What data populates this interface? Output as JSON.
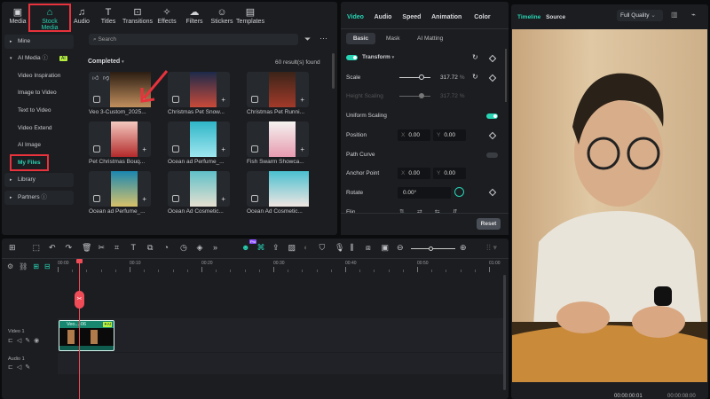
{
  "toolbar": {
    "tabs": [
      {
        "label": "Media",
        "icon": "media-icon"
      },
      {
        "label": "Stock Media",
        "icon": "stock-media-icon",
        "selected": true
      },
      {
        "label": "Audio",
        "icon": "audio-icon"
      },
      {
        "label": "Titles",
        "icon": "titles-icon"
      },
      {
        "label": "Transitions",
        "icon": "transitions-icon"
      },
      {
        "label": "Effects",
        "icon": "effects-icon"
      },
      {
        "label": "Filters",
        "icon": "filters-icon"
      },
      {
        "label": "Stickers",
        "icon": "stickers-icon"
      },
      {
        "label": "Templates",
        "icon": "templates-icon"
      }
    ]
  },
  "sidebar": {
    "mine": "Mine",
    "ai_media": "AI Media",
    "ai_badge": "AI",
    "items": [
      "Video Inspiration",
      "Image to Video",
      "Text to Video",
      "Video Extend",
      "AI Image",
      "My Files"
    ],
    "library": "Library",
    "partners": "Partners"
  },
  "library": {
    "search_placeholder": "Search",
    "section": "Completed",
    "results": "60 result(s) found",
    "cards": [
      "Veo 3-Custom_2025...",
      "Christmas Pet Snow...",
      "Christmas Pet Runni...",
      "Pet Christmas Bouq...",
      "Ocean ad Perfume_...",
      "Fish Swarm Showca...",
      "Ocean ad Perfume_...",
      "Ocean Ad Cosmetic...",
      "Ocean Ad Cosmetic..."
    ]
  },
  "properties": {
    "tabs": [
      "Video",
      "Audio",
      "Speed",
      "Animation",
      "Color"
    ],
    "subtabs": [
      "Basic",
      "Mask",
      "AI Matting"
    ],
    "transform": "Transform",
    "scale_label": "Scale",
    "scale_value": "317.72",
    "height_label": "Height Scaling",
    "height_value": "317.72",
    "unit": "%",
    "uniform": "Uniform Scaling",
    "position": "Position",
    "pos_x": "0.00",
    "pos_y": "0.00",
    "path_curve": "Path Curve",
    "anchor": "Anchor Point",
    "anc_x": "0.00",
    "anc_y": "0.00",
    "rotate": "Rotate",
    "rotate_value": "0.00°",
    "flip": "Flip",
    "x": "X",
    "y": "Y",
    "reset": "Reset"
  },
  "preview": {
    "tabs": [
      "Timeline",
      "Source"
    ],
    "quality": "Full Quality",
    "current_time": "00:00:00:01",
    "total_time": "00:00:08:00"
  },
  "timeline": {
    "ticks": [
      "00:00",
      "00:10",
      "00:20",
      "00:30",
      "00:40",
      "00:50",
      "01:00"
    ],
    "tracks": [
      "Video 1",
      "Audio 1"
    ],
    "clip_label": "Veo...-06",
    "clip_badge": "AI",
    "pro_badge": "Pro"
  },
  "colors": {
    "accent": "#27d4b4",
    "highlight": "#e8323c"
  }
}
